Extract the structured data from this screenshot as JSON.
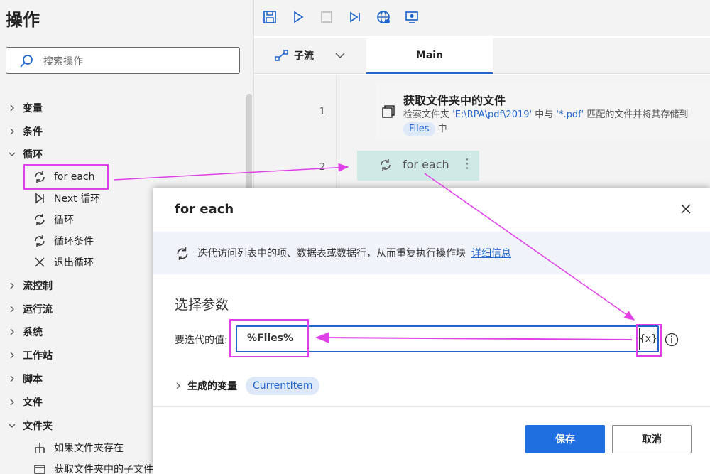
{
  "actions_panel": {
    "title": "操作",
    "search_placeholder": "搜索操作",
    "categories": [
      {
        "label": "变量",
        "expanded": false
      },
      {
        "label": "条件",
        "expanded": false
      },
      {
        "label": "循环",
        "expanded": true
      },
      {
        "label": "流控制",
        "expanded": false
      },
      {
        "label": "运行流",
        "expanded": false
      },
      {
        "label": "系统",
        "expanded": false
      },
      {
        "label": "工作站",
        "expanded": false
      },
      {
        "label": "脚本",
        "expanded": false
      },
      {
        "label": "文件",
        "expanded": false
      },
      {
        "label": "文件夹",
        "expanded": true
      }
    ],
    "loop_items": [
      {
        "label": "for each",
        "icon": "loop-icon"
      },
      {
        "label": "Next 循环",
        "icon": "next-icon"
      },
      {
        "label": "循环",
        "icon": "loop-icon"
      },
      {
        "label": "循环条件",
        "icon": "loop-icon"
      },
      {
        "label": "退出循环",
        "icon": "exit-icon"
      }
    ],
    "folder_items": [
      {
        "label": "如果文件夹存在",
        "icon": "branch-icon"
      },
      {
        "label": "获取文件夹中的子文件夹",
        "icon": "folder-icon"
      }
    ]
  },
  "toolbar": {
    "icons": [
      "save-icon",
      "run-icon",
      "stop-icon",
      "step-icon",
      "web-recorder-icon",
      "desktop-recorder-icon"
    ]
  },
  "tabs": {
    "subflow_label": "子流",
    "main_label": "Main"
  },
  "flow": {
    "lines": [
      {
        "num": "1",
        "title": "获取文件夹中的文件",
        "desc_prefix": "检索文件夹 ",
        "folder": "'E:\\RPA\\pdf\\2019'",
        "desc_mid": " 中与 ",
        "pattern": "'*.pdf'",
        "desc_suffix": " 匹配的文件并将其存储到 ",
        "var": "Files",
        "desc_end": " 中"
      },
      {
        "num": "2",
        "title": "for each"
      }
    ]
  },
  "dialog": {
    "title": "for each",
    "info_text": "迭代访问列表中的项、数据表或数据行，从而重复执行操作块",
    "info_link": "详细信息",
    "section_title": "选择参数",
    "param_label": "要迭代的值:",
    "param_value": "%Files%",
    "var_button": "{x}",
    "generated_label": "生成的变量",
    "generated_var": "CurrentItem",
    "save_label": "保存",
    "cancel_label": "取消"
  },
  "colors": {
    "accent": "#1f6fe0",
    "annotation": "#e040e8",
    "foreach_card": "#cfe9e7"
  }
}
